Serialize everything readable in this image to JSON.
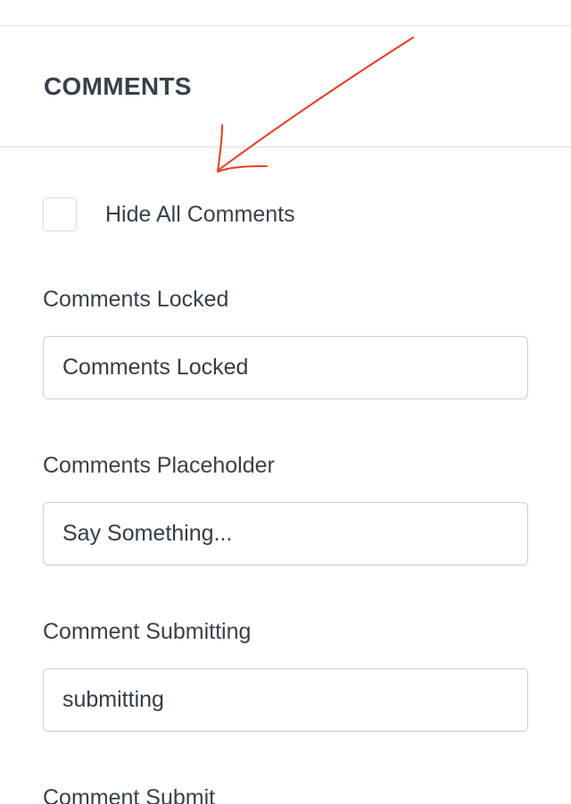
{
  "section": {
    "title": "COMMENTS"
  },
  "hide_all_comments": {
    "label": "Hide All Comments",
    "checked": false
  },
  "fields": [
    {
      "label": "Comments Locked",
      "value": "Comments Locked"
    },
    {
      "label": "Comments Placeholder",
      "value": "Say Something..."
    },
    {
      "label": "Comment Submitting",
      "value": "submitting"
    },
    {
      "label": "Comment Submit",
      "value": ""
    }
  ],
  "colors": {
    "annotation_arrow": "#ee3a1f",
    "text": "#37414b",
    "divider": "#dde1e5",
    "input_border": "#c8cfd6"
  }
}
